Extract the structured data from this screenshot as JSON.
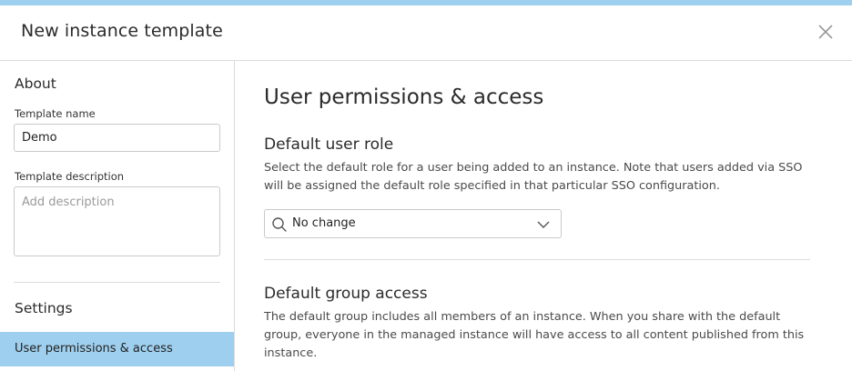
{
  "header": {
    "title": "New instance template",
    "close_icon": "close-icon"
  },
  "sidebar": {
    "about_heading": "About",
    "template_name_label": "Template name",
    "template_name_value": "Demo",
    "template_description_label": "Template description",
    "template_description_placeholder": "Add description",
    "settings_heading": "Settings",
    "items": [
      {
        "label": "User permissions & access",
        "selected": true
      }
    ]
  },
  "main": {
    "title": "User permissions & access",
    "default_user_role": {
      "title": "Default user role",
      "description": "Select the default role for a user being added to an instance. Note that users added via SSO will be assigned the default role specified in that particular SSO configuration.",
      "dropdown_value": "No change",
      "dropdown_icons": [
        "search-icon",
        "chevron-down-icon"
      ]
    },
    "default_group_access": {
      "title": "Default group access",
      "description": "The default group includes all members of an instance. When you share with the default group, everyone in the managed instance will have access to all content published from this instance."
    }
  },
  "colors": {
    "accent": "#9fcfee",
    "border": "#dcdcdc",
    "text": "#2b2b2b"
  }
}
